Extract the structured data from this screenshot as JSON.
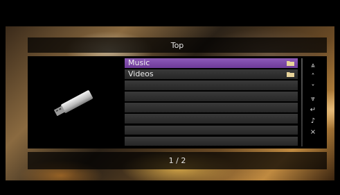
{
  "header": {
    "title": "Top"
  },
  "device": {
    "icon": "usb-drive-icon"
  },
  "list": {
    "items": [
      {
        "label": "Music",
        "icon": "folder-icon",
        "selected": true
      },
      {
        "label": "Videos",
        "icon": "folder-icon",
        "selected": false
      },
      {
        "label": ""
      },
      {
        "label": ""
      },
      {
        "label": ""
      },
      {
        "label": ""
      },
      {
        "label": ""
      },
      {
        "label": ""
      }
    ]
  },
  "controls": [
    {
      "name": "page-up-icon",
      "glyph": "⩓"
    },
    {
      "name": "up-icon",
      "glyph": "˄"
    },
    {
      "name": "down-icon",
      "glyph": "˅"
    },
    {
      "name": "page-down-icon",
      "glyph": "⩔"
    },
    {
      "name": "return-icon",
      "glyph": "↵"
    },
    {
      "name": "now-playing-icon",
      "glyph": "♪"
    },
    {
      "name": "close-icon",
      "glyph": "×"
    }
  ],
  "footer": {
    "page": "1 / 2"
  },
  "colors": {
    "selected": "#7b47a8",
    "row": "#303030"
  }
}
